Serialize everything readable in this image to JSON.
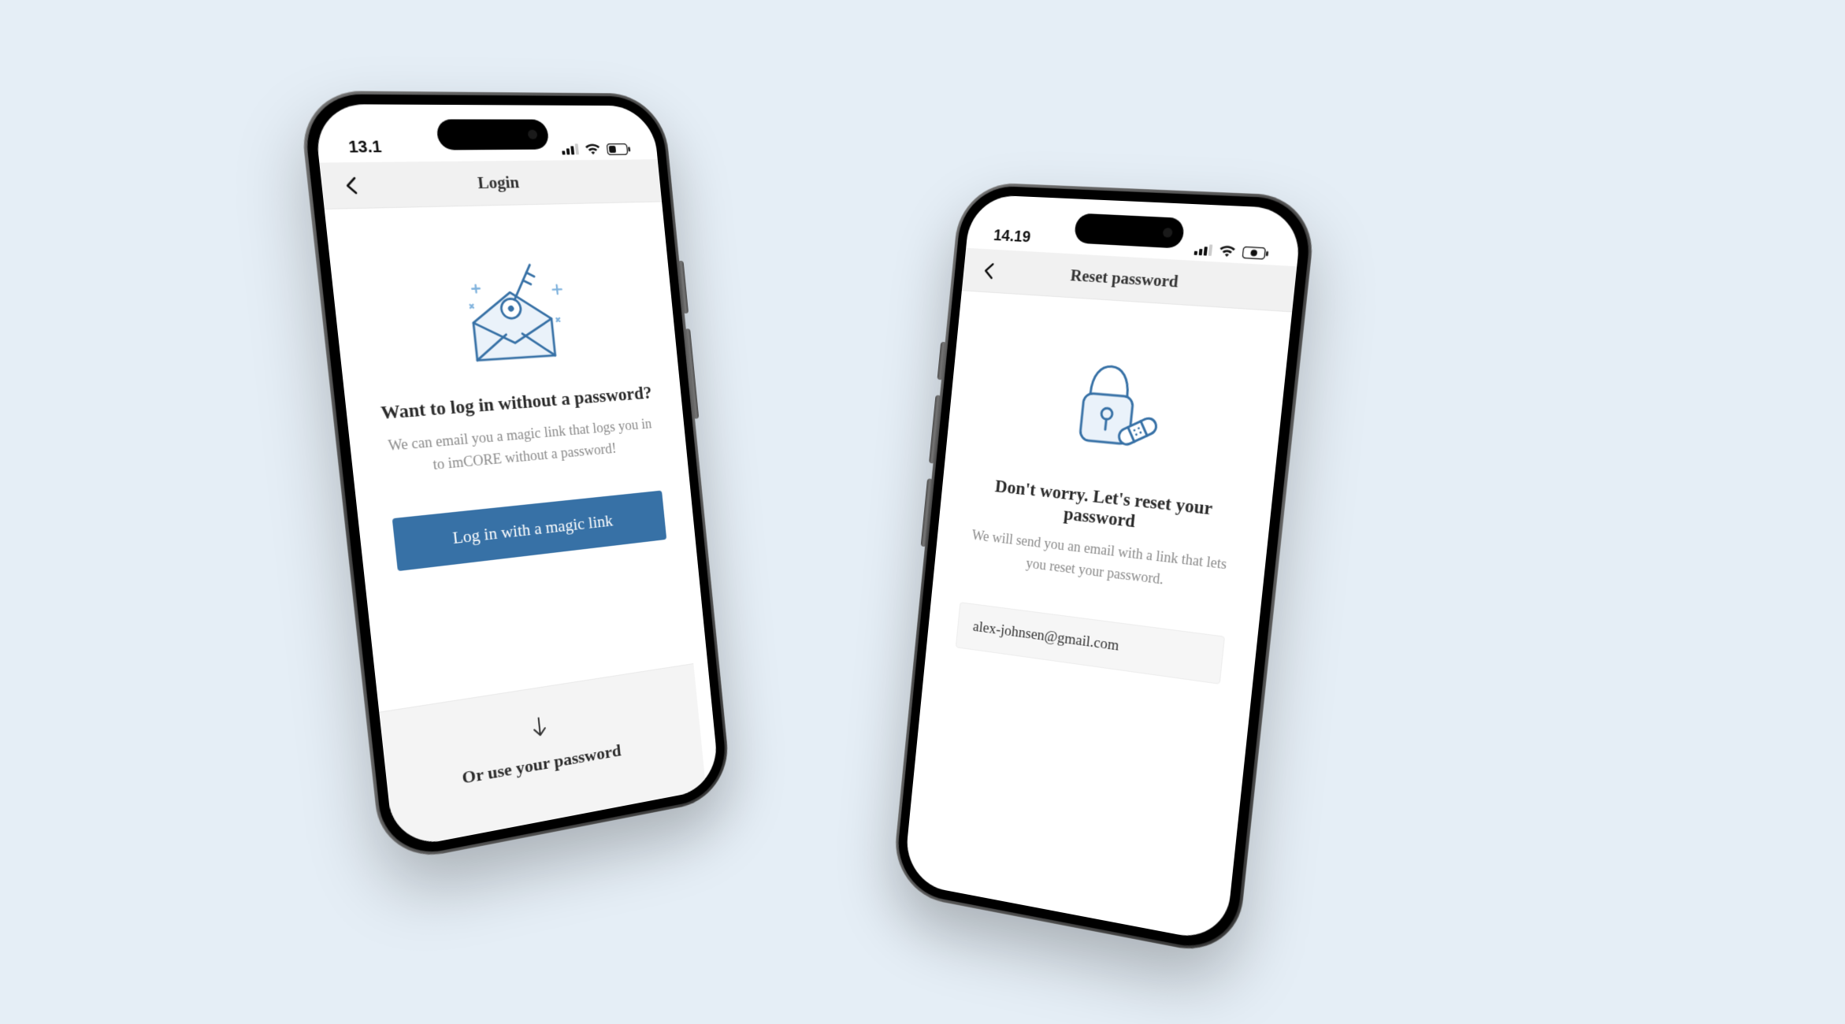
{
  "left": {
    "status_time": "13.1",
    "nav_title": "Login",
    "headline": "Want to log in without a password?",
    "subtext": "We can email you a magic link that logs you in to imCORE without a password!",
    "primary_button": "Log in with a magic link",
    "alt_heading": "Or use your password"
  },
  "right": {
    "status_time": "14.19",
    "nav_title": "Reset password",
    "headline": "Don't worry. Let's reset your password",
    "subtext": "We will send you an email with a link that lets you reset your password.",
    "email_value": "alex-johnsen@gmail.com"
  },
  "colors": {
    "accent": "#3771a6",
    "bg": "#e5eef6"
  }
}
